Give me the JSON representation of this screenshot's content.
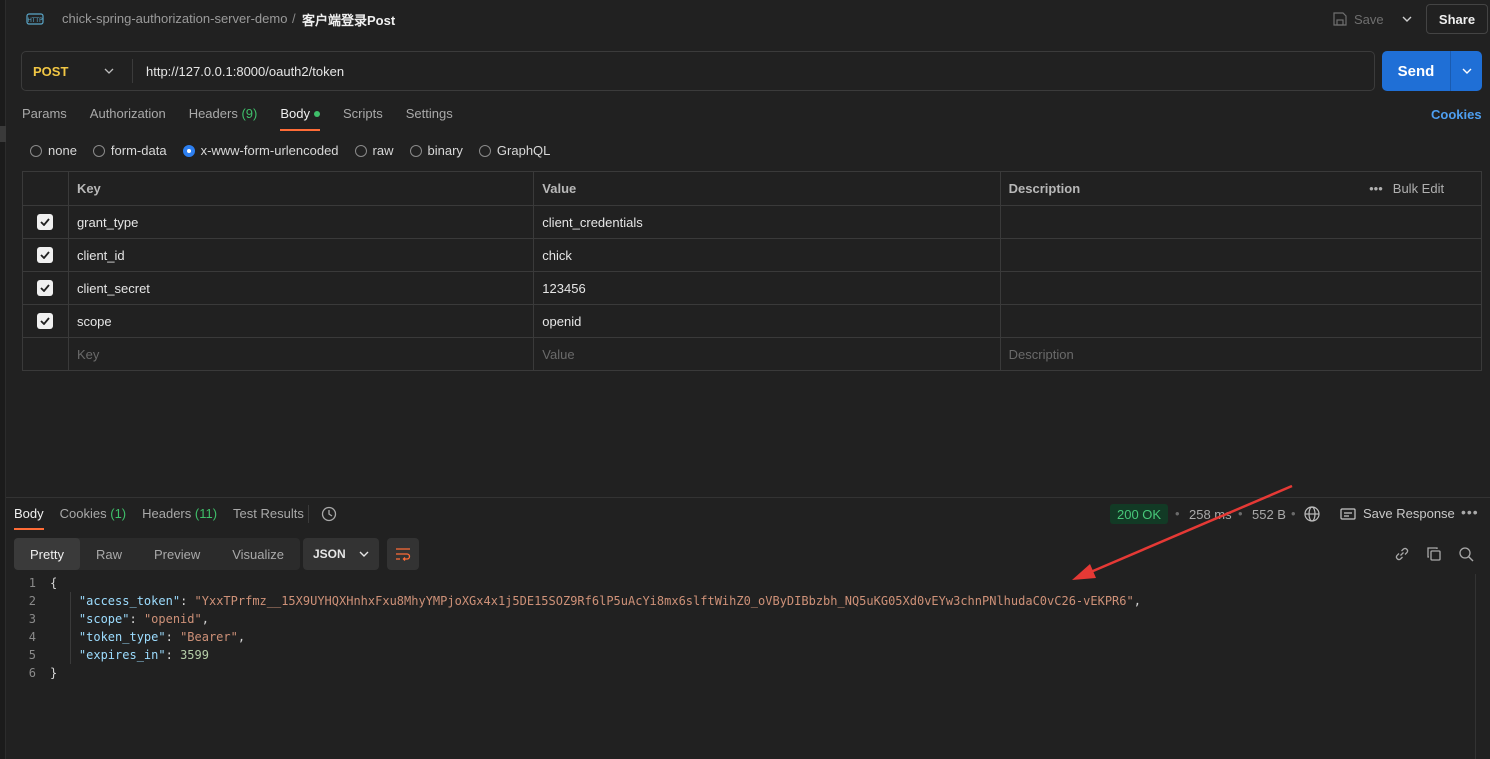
{
  "header": {
    "icon": "http-icon",
    "collection": "chick-spring-authorization-server-demo",
    "separator": "/",
    "request_name": "客户端登录Post",
    "save_label": "Save",
    "share_label": "Share"
  },
  "request": {
    "method": "POST",
    "url": "http://127.0.0.1:8000/oauth2/token",
    "send_label": "Send"
  },
  "tabs": {
    "params": "Params",
    "authorization": "Authorization",
    "headers": "Headers",
    "headers_count": "(9)",
    "body": "Body",
    "scripts": "Scripts",
    "settings": "Settings",
    "cookies": "Cookies"
  },
  "body_types": {
    "none": "none",
    "form_data": "form-data",
    "urlencoded": "x-www-form-urlencoded",
    "raw": "raw",
    "binary": "binary",
    "graphql": "GraphQL",
    "selected": "x-www-form-urlencoded"
  },
  "params_table": {
    "col_key": "Key",
    "col_value": "Value",
    "col_description": "Description",
    "bulk_edit": "Bulk Edit",
    "rows": [
      {
        "key": "grant_type",
        "value": "client_credentials",
        "checked": true
      },
      {
        "key": "client_id",
        "value": "chick",
        "checked": true
      },
      {
        "key": "client_secret",
        "value": "123456",
        "checked": true
      },
      {
        "key": "scope",
        "value": "openid",
        "checked": true
      }
    ],
    "placeholder_key": "Key",
    "placeholder_value": "Value",
    "placeholder_description": "Description"
  },
  "response": {
    "tabs": {
      "body": "Body",
      "cookies": "Cookies",
      "cookies_count": "(1)",
      "headers": "Headers",
      "headers_count": "(11)",
      "test_results": "Test Results"
    },
    "status": "200 OK",
    "time": "258 ms",
    "size": "552 B",
    "save_response": "Save Response",
    "view": {
      "pretty": "Pretty",
      "raw": "Raw",
      "preview": "Preview",
      "visualize": "Visualize"
    },
    "format": "JSON",
    "lines": {
      "n1": "1",
      "n2": "2",
      "n3": "3",
      "n4": "4",
      "n5": "5",
      "n6": "6",
      "open": "{",
      "close": "}",
      "k_access_token": "\"access_token\"",
      "v_access_token": "\"YxxTPrfmz__15X9UYHQXHnhxFxu8MhyYMPjoXGx4x1j5DE15SOZ9Rf6lP5uAcYi8mx6slftWihZ0_oVByDIBbzbh_NQ5uKG05Xd0vEYw3chnPNlhudaC0vC26-vEKPR6\"",
      "k_scope": "\"scope\"",
      "v_scope": "\"openid\"",
      "k_token_type": "\"token_type\"",
      "v_token_type": "\"Bearer\"",
      "k_expires_in": "\"expires_in\"",
      "v_expires_in": "3599"
    }
  },
  "colors": {
    "accent_orange": "#ff6c37",
    "send_blue": "#1f6fd6",
    "method_yellow": "#f2c744",
    "status_green": "#47c779",
    "annotation_red": "#e53935"
  }
}
